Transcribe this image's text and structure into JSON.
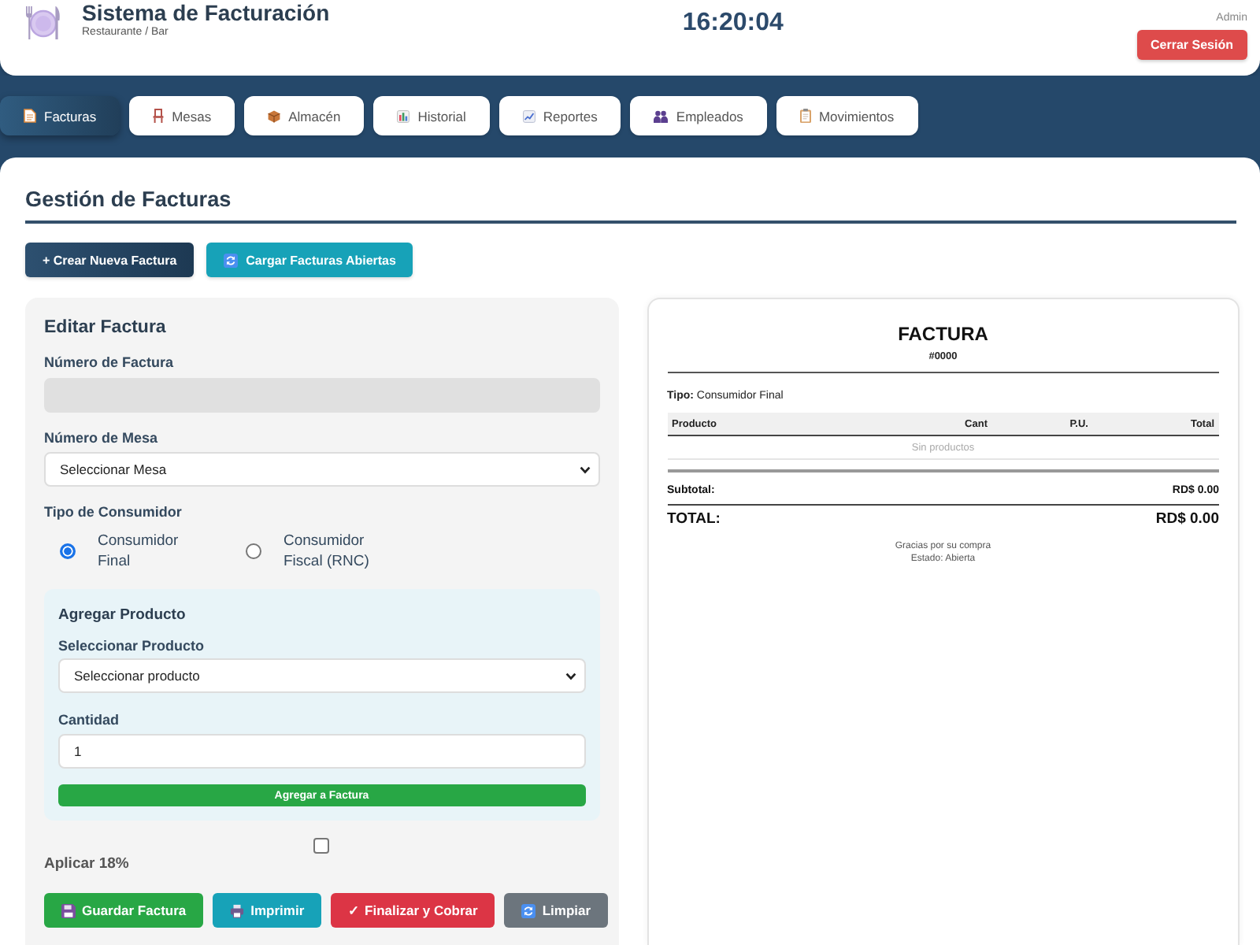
{
  "header": {
    "title": "Sistema de Facturación",
    "subtitle": "Restaurante / Bar",
    "clock": "16:20:04",
    "user": "Admin",
    "logout_button": "Cerrar Sesión"
  },
  "nav_tabs": [
    {
      "label": "Facturas",
      "selected": true
    },
    {
      "label": "Mesas",
      "selected": false
    },
    {
      "label": "Almacén",
      "selected": false
    },
    {
      "label": "Historial",
      "selected": false
    },
    {
      "label": "Reportes",
      "selected": false
    },
    {
      "label": "Empleados",
      "selected": false
    },
    {
      "label": "Movimientos",
      "selected": false
    }
  ],
  "page": {
    "title": "Gestión de Facturas",
    "actions": [
      {
        "label": "+ Crear Nueva Factura",
        "kind": "primary"
      },
      {
        "label": "Cargar Facturas Abiertas",
        "kind": "info"
      }
    ]
  },
  "editor": {
    "title": "Editar Factura",
    "invoice_number": {
      "label": "Número de Factura",
      "disabled": true
    },
    "table": {
      "label": "Número de Mesa",
      "value": "Seleccionar Mesa"
    },
    "consumer_type": {
      "label": "Tipo de Consumidor",
      "options": [
        {
          "label": "Consumidor Final",
          "selected": true
        },
        {
          "label": "Consumidor Fiscal (RNC)",
          "selected": false
        }
      ]
    },
    "add_product": {
      "title": "Agregar Producto",
      "product": {
        "label": "Seleccionar Producto",
        "value": "Seleccionar producto"
      },
      "quantity": {
        "label": "Cantidad",
        "value": "1"
      },
      "button": "Agregar a Factura"
    },
    "tax_option": {
      "label": "Aplicar 18%",
      "checked": false
    },
    "actions": [
      {
        "label": "Guardar Factura",
        "kind": "success"
      },
      {
        "label": "Imprimir",
        "kind": "info"
      },
      {
        "label": "✓ Finalizar y Cobrar",
        "kind": "danger"
      },
      {
        "label": "Limpiar",
        "kind": "secondary"
      }
    ]
  },
  "invoice": {
    "title": "FACTURA",
    "number": "#0000",
    "type": "**Tipo:** Consumidor Final",
    "columns": [
      "Producto",
      "Cant",
      "P.U.",
      "Total"
    ],
    "empty_message": "Sin productos",
    "subtotal": {
      "label": "Subtotal:",
      "value": "RD$ 0.00"
    },
    "total": {
      "label": "TOTAL:",
      "value": "RD$ 0.00"
    },
    "footer": [
      "Gracias por su compra",
      "Estado: Abierta"
    ]
  }
}
